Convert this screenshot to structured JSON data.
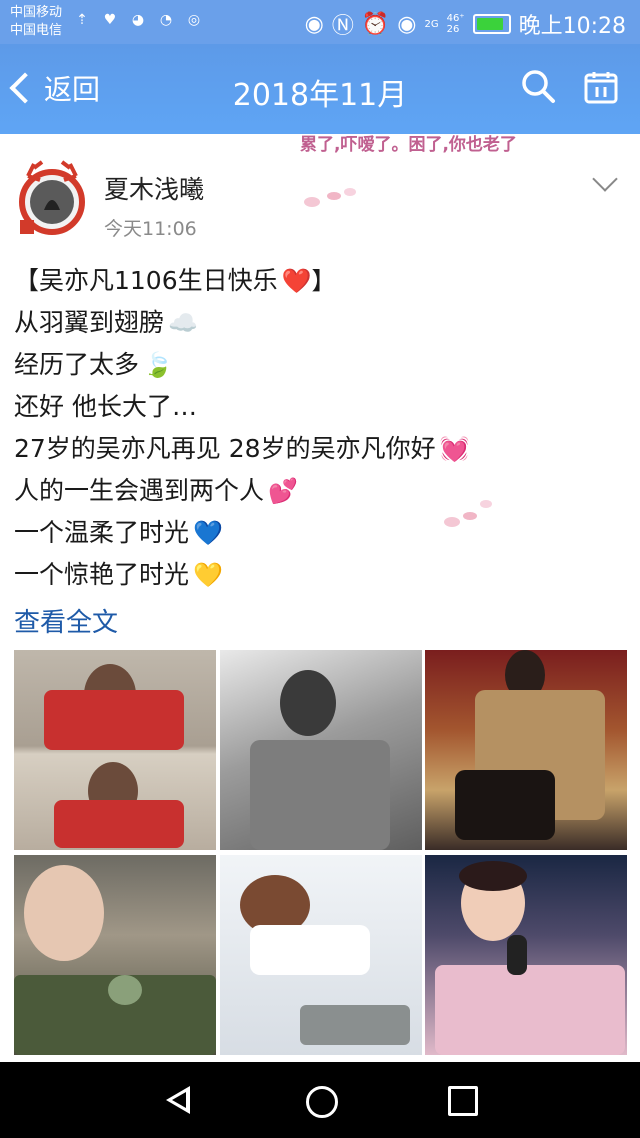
{
  "status_bar": {
    "carrier_1": "中国移动",
    "carrier_2": "中国电信",
    "network_top": "46⁺",
    "network_bottom": "26",
    "network_small": "2G",
    "time": "晚上10:28"
  },
  "header": {
    "back_label": "返回",
    "title": "2018年11月"
  },
  "banner_text": "累了,吓嗳了。困了,你也老了",
  "post": {
    "author": "夏木浅曦",
    "timestamp": "今天11:06",
    "lines": [
      {
        "text": "【吴亦凡1106生日快乐",
        "emoji": "❤️】"
      },
      {
        "text": "从羽翼到翅膀",
        "emoji": "☁️"
      },
      {
        "text": "经历了太多",
        "emoji": "🍃"
      },
      {
        "text": "还好  他长大了…",
        "emoji": ""
      },
      {
        "text": "27岁的吴亦凡再见 28岁的吴亦凡你好",
        "emoji": "💓"
      },
      {
        "text": "人的一生会遇到两个人",
        "emoji": "💕"
      },
      {
        "text": "一个温柔了时光",
        "emoji": "💙"
      },
      {
        "text": "一个惊艳了时光",
        "emoji": "💛"
      }
    ],
    "view_full": "查看全文"
  },
  "colors": {
    "header": "#5fa5f5",
    "link": "#1e5aa8",
    "navbar": "#000000"
  }
}
